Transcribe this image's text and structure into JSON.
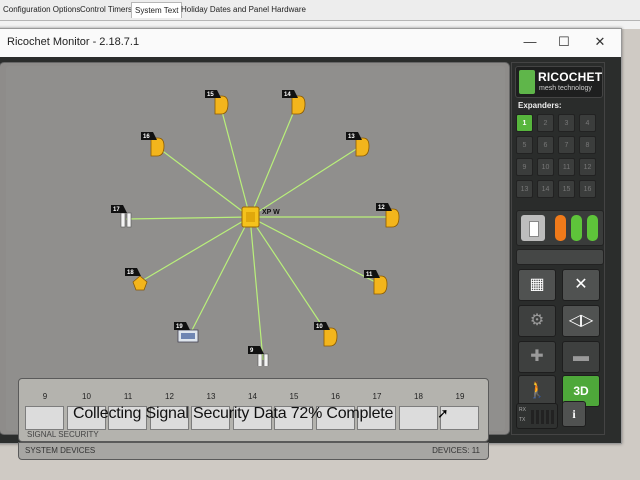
{
  "parent_tabs": [
    "Configuration Options",
    "Control Timers",
    "System Text",
    "Holiday Dates and Panel Hardware"
  ],
  "window": {
    "title": "Ricochet Monitor - 2.18.7.1",
    "controls": {
      "minimize": "—",
      "maximize": "☐",
      "close": "✕"
    }
  },
  "network": {
    "hub_label": "XP W",
    "link_color": "#b9f07a",
    "device_color": "#f3b51c",
    "devices": [
      {
        "id": "15",
        "icon": "detector-icon"
      },
      {
        "id": "14",
        "icon": "detector-icon"
      },
      {
        "id": "16",
        "icon": "detector-icon"
      },
      {
        "id": "13",
        "icon": "detector-icon"
      },
      {
        "id": "17",
        "icon": "contact-icon"
      },
      {
        "id": "12",
        "icon": "detector-icon"
      },
      {
        "id": "18",
        "icon": "sounder-icon"
      },
      {
        "id": "11",
        "icon": "detector-icon"
      },
      {
        "id": "19",
        "icon": "keypad-icon"
      },
      {
        "id": "10",
        "icon": "detector-icon"
      },
      {
        "id": "9",
        "icon": "contact-icon"
      }
    ]
  },
  "signal_security": {
    "slots": [
      "9",
      "10",
      "11",
      "12",
      "13",
      "14",
      "15",
      "16",
      "17",
      "18",
      "19"
    ],
    "status_text": "Collecting Signal Security Data 72% Complete",
    "progress_percent": 72,
    "label": "SIGNAL SECURITY"
  },
  "system_devices": {
    "label": "SYSTEM DEVICES",
    "count_text": "DEVICES: 11"
  },
  "panel": {
    "logo_title": "RICOCHET",
    "logo_subtitle": "mesh technology",
    "expanders_label": "Expanders:",
    "expanders": [
      "1",
      "2",
      "3",
      "4",
      "5",
      "6",
      "7",
      "8",
      "9",
      "10",
      "11",
      "12",
      "13",
      "14",
      "15",
      "16"
    ],
    "active_expander": "1",
    "status_colors": [
      "#f07a1a",
      "#5ec43a",
      "#5ec43a"
    ],
    "tools": [
      {
        "name": "grid-view-icon"
      },
      {
        "name": "network-view-icon"
      },
      {
        "name": "settings-icon"
      },
      {
        "name": "playback-icon"
      },
      {
        "name": "zoom-in-icon"
      },
      {
        "name": "zoom-out-icon"
      },
      {
        "name": "walk-test-icon"
      },
      {
        "name": "3d-view-icon",
        "label": "3D"
      }
    ],
    "meter_labels": [
      "RX",
      "TX"
    ],
    "info_label": "i"
  }
}
